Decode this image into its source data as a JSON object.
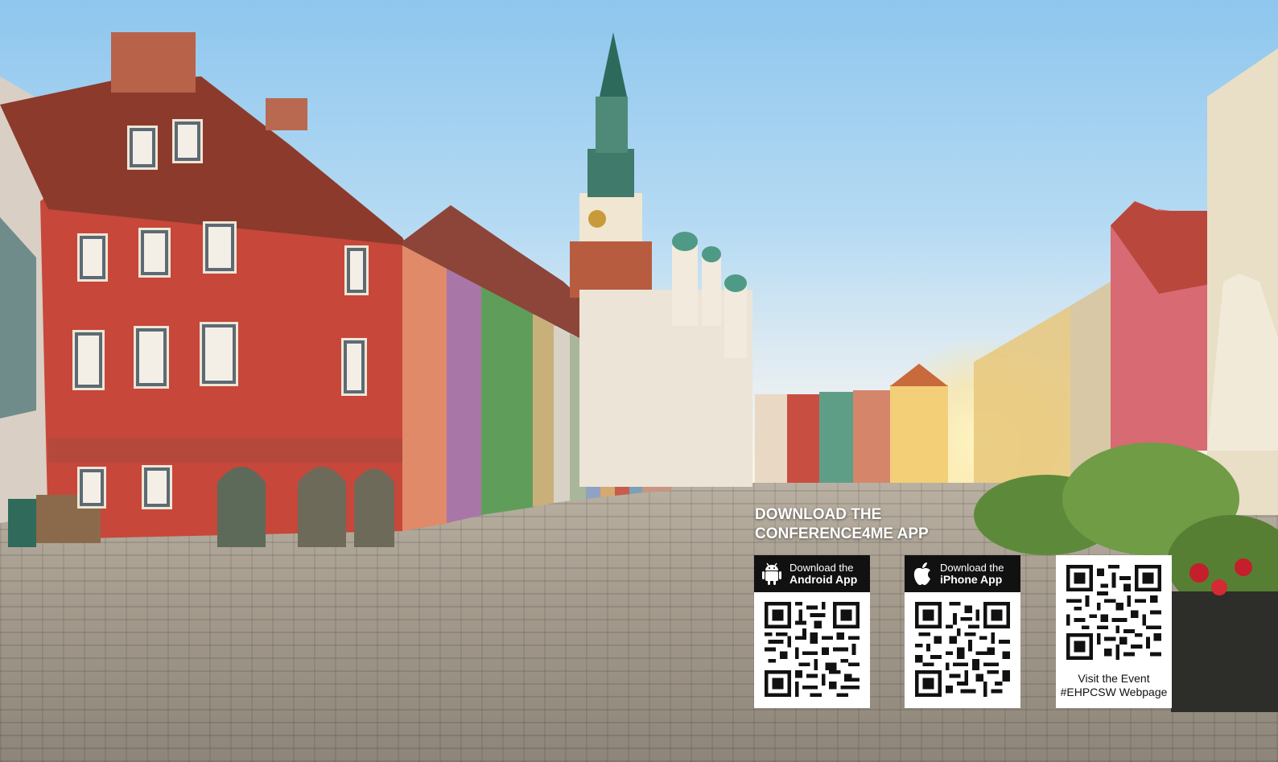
{
  "promo": {
    "heading_line1": "DOWNLOAD THE",
    "heading_line2": "CONFERENCE4ME APP"
  },
  "cards": {
    "android": {
      "line1": "Download the",
      "line2": "Android App",
      "icon": "android-icon"
    },
    "iphone": {
      "line1": "Download the",
      "line2": "iPhone App",
      "icon": "apple-icon"
    },
    "event": {
      "line1": "Visit the Event",
      "line2": "#EHPCSW Webpage"
    }
  }
}
